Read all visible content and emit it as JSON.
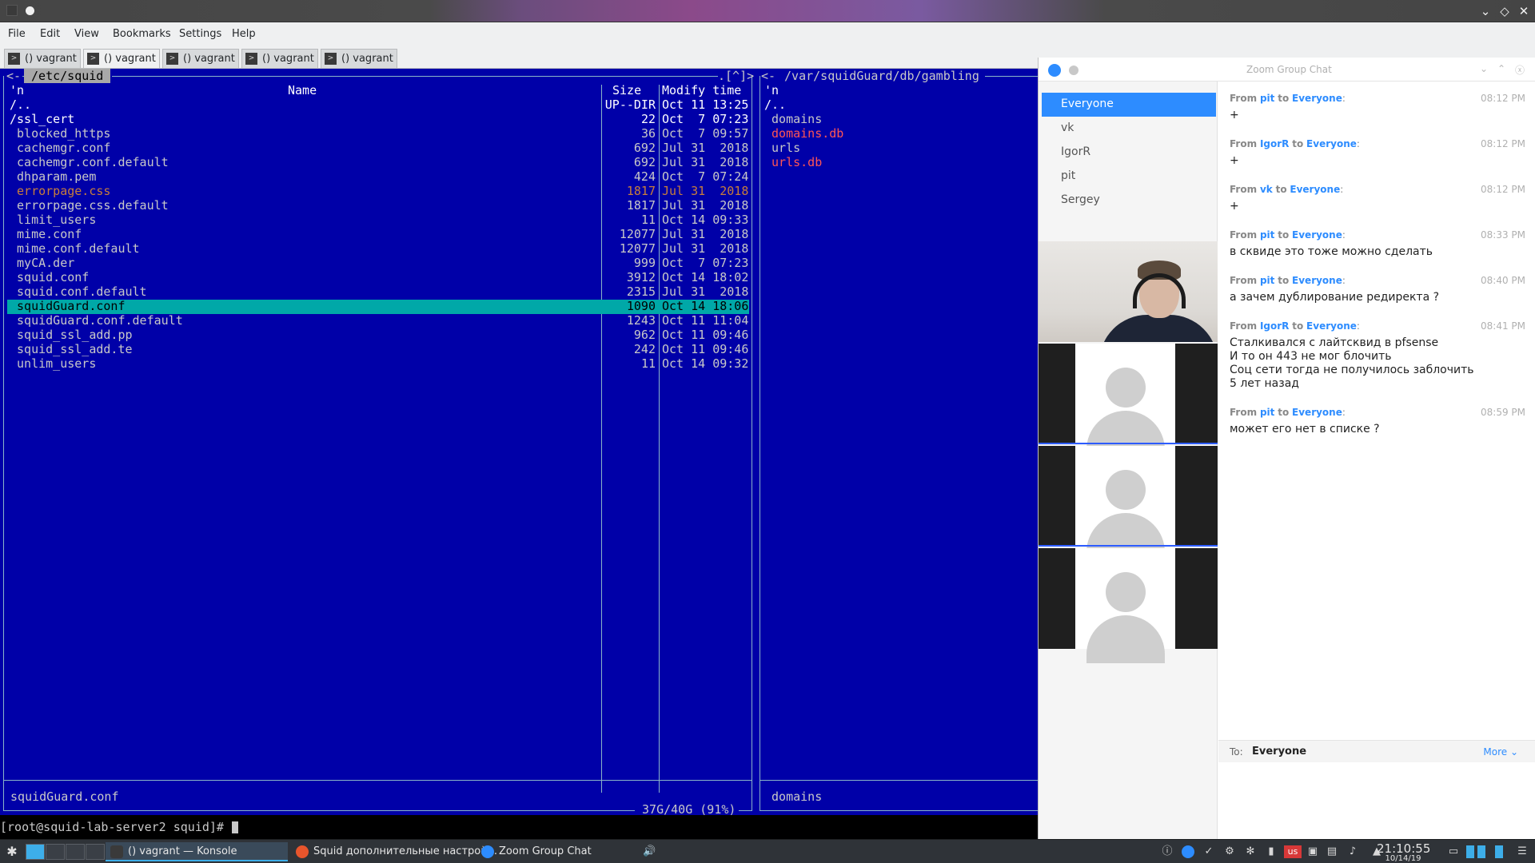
{
  "menu": [
    "File",
    "Edit",
    "View",
    "Bookmarks",
    "Settings",
    "Help"
  ],
  "tabs": [
    "() vagrant",
    "() vagrant",
    "() vagrant",
    "() vagrant",
    "() vagrant"
  ],
  "left_panel": {
    "path": " /etc/squid ",
    "right_marker": ".[^]>",
    "header_n": "'n",
    "header_name": "Name",
    "header_size": "Size",
    "header_mtime": "Modify time",
    "rows": [
      {
        "name": "/..",
        "size": "UP--DIR",
        "date": "Oct 11 13:25"
      },
      {
        "name": "/ssl_cert",
        "size": "22",
        "date": "Oct  7 07:23"
      },
      {
        "name": " blocked_https",
        "size": "36",
        "date": "Oct  7 09:57"
      },
      {
        "name": " cachemgr.conf",
        "size": "692",
        "date": "Jul 31  2018"
      },
      {
        "name": " cachemgr.conf.default",
        "size": "692",
        "date": "Jul 31  2018"
      },
      {
        "name": " dhparam.pem",
        "size": "424",
        "date": "Oct  7 07:24"
      },
      {
        "name": " errorpage.css",
        "size": "1817",
        "date": "Jul 31  2018"
      },
      {
        "name": " errorpage.css.default",
        "size": "1817",
        "date": "Jul 31  2018"
      },
      {
        "name": " limit_users",
        "size": "11",
        "date": "Oct 14 09:33"
      },
      {
        "name": " mime.conf",
        "size": "12077",
        "date": "Jul 31  2018"
      },
      {
        "name": " mime.conf.default",
        "size": "12077",
        "date": "Jul 31  2018"
      },
      {
        "name": " myCA.der",
        "size": "999",
        "date": "Oct  7 07:23"
      },
      {
        "name": " squid.conf",
        "size": "3912",
        "date": "Oct 14 18:02"
      },
      {
        "name": " squid.conf.default",
        "size": "2315",
        "date": "Jul 31  2018"
      },
      {
        "name": " squidGuard.conf",
        "size": "1090",
        "date": "Oct 14 18:06"
      },
      {
        "name": " squidGuard.conf.default",
        "size": "1243",
        "date": "Oct 11 11:04"
      },
      {
        "name": " squid_ssl_add.pp",
        "size": "962",
        "date": "Oct 11 09:46"
      },
      {
        "name": " squid_ssl_add.te",
        "size": "242",
        "date": "Oct 11 09:46"
      },
      {
        "name": " unlim_users",
        "size": "11",
        "date": "Oct 14 09:32"
      }
    ],
    "status": " squidGuard.conf",
    "disk": " 37G/40G (91%) "
  },
  "right_panel": {
    "path": " /var/squidGuard/db/gambling ",
    "header_n": "'n",
    "rows": [
      {
        "name": "/..",
        "color": "white"
      },
      {
        "name": " domains",
        "color": "grey"
      },
      {
        "name": " domains.db",
        "color": "red"
      },
      {
        "name": " urls",
        "color": "grey"
      },
      {
        "name": " urls.db",
        "color": "red"
      }
    ],
    "status": " domains"
  },
  "shell_prompt": "[root@squid-lab-server2 squid]# ",
  "zoom": {
    "title": "Zoom Group Chat",
    "participants": [
      "Everyone",
      "vk",
      "IgorR",
      "pit",
      "Sergey"
    ],
    "messages": [
      {
        "from": "pit",
        "to": "Everyone",
        "time": "08:12 PM",
        "text": "+"
      },
      {
        "from": "IgorR",
        "to": "Everyone",
        "time": "08:12 PM",
        "text": "+"
      },
      {
        "from": "vk",
        "to": "Everyone",
        "time": "08:12 PM",
        "text": "+"
      },
      {
        "from": "pit",
        "to": "Everyone",
        "time": "08:33 PM",
        "text": "в сквиде это тоже можно сделать"
      },
      {
        "from": "pit",
        "to": "Everyone",
        "time": "08:40 PM",
        "text": "а зачем дублирование редиректа ?"
      },
      {
        "from": "IgorR",
        "to": "Everyone",
        "time": "08:41 PM",
        "text": "Сталкивался с лайтсквид в pfsense\nИ то он 443 не мог блочить\nСоц сети тогда не получилось заблочить\n5 лет назад"
      },
      {
        "from": "pit",
        "to": "Everyone",
        "time": "08:59 PM",
        "text": "может его нет в списке ?"
      }
    ],
    "from_label": "From",
    "to_label": "to",
    "to_field_label": "To:",
    "to_field_value": "Everyone",
    "more_label": "More ⌄"
  },
  "taskbar": {
    "tasks": [
      {
        "label": "() vagrant — Konsole",
        "active": true
      },
      {
        "label": "Squid дополнительные настрой...",
        "active": false
      },
      {
        "label": "Zoom Group Chat",
        "active": false
      }
    ],
    "clock_time": "21:10:55",
    "clock_date": "10/14/19",
    "keyboard_layout": "us"
  }
}
